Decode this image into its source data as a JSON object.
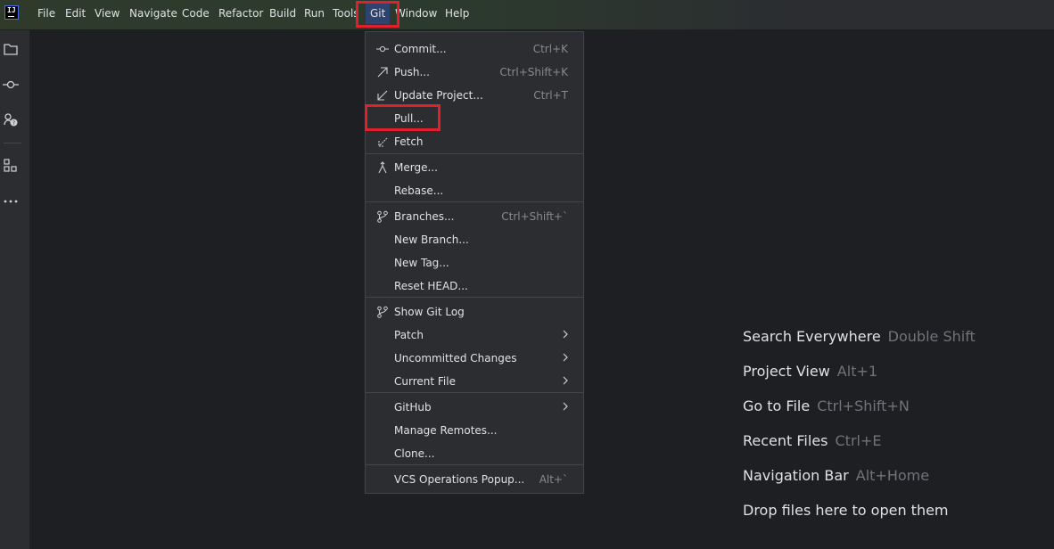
{
  "menubar": {
    "items": [
      "File",
      "Edit",
      "View",
      "Navigate",
      "Code",
      "Refactor",
      "Build",
      "Run",
      "Tools",
      "Git",
      "Window",
      "Help"
    ]
  },
  "git_menu": {
    "commit": {
      "label": "Commit...",
      "shortcut": "Ctrl+K"
    },
    "push": {
      "label": "Push...",
      "shortcut": "Ctrl+Shift+K"
    },
    "update": {
      "label": "Update Project...",
      "shortcut": "Ctrl+T"
    },
    "pull": {
      "label": "Pull..."
    },
    "fetch": {
      "label": "Fetch"
    },
    "merge": {
      "label": "Merge..."
    },
    "rebase": {
      "label": "Rebase..."
    },
    "branches": {
      "label": "Branches...",
      "shortcut": "Ctrl+Shift+`"
    },
    "new_branch": {
      "label": "New Branch..."
    },
    "new_tag": {
      "label": "New Tag..."
    },
    "reset_head": {
      "label": "Reset HEAD..."
    },
    "show_log": {
      "label": "Show Git Log"
    },
    "patch": {
      "label": "Patch"
    },
    "uncommitted": {
      "label": "Uncommitted Changes"
    },
    "current_file": {
      "label": "Current File"
    },
    "github": {
      "label": "GitHub"
    },
    "manage_remotes": {
      "label": "Manage Remotes..."
    },
    "clone": {
      "label": "Clone..."
    },
    "vcs_popup": {
      "label": "VCS Operations Popup...",
      "shortcut": "Alt+`"
    }
  },
  "hints": {
    "search": {
      "label": "Search Everywhere",
      "key": "Double Shift"
    },
    "project": {
      "label": "Project View",
      "key": "Alt+1"
    },
    "goto": {
      "label": "Go to File",
      "key": "Ctrl+Shift+N"
    },
    "recent": {
      "label": "Recent Files",
      "key": "Ctrl+E"
    },
    "navbar": {
      "label": "Navigation Bar",
      "key": "Alt+Home"
    },
    "drop": {
      "label": "Drop files here to open them"
    }
  },
  "colors": {
    "highlight_box": "#e0202a",
    "menu_bg": "#2b2d30",
    "editor_bg": "#1e1f22"
  }
}
